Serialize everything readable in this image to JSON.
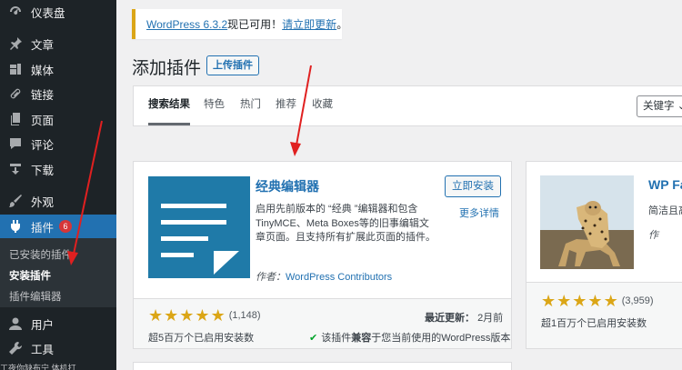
{
  "sidebar": {
    "items": [
      {
        "label": "仪表盘",
        "icon": "dashboard-icon"
      },
      {
        "label": "文章",
        "icon": "pin-icon"
      },
      {
        "label": "媒体",
        "icon": "media-icon"
      },
      {
        "label": "链接",
        "icon": "link-icon"
      },
      {
        "label": "页面",
        "icon": "page-icon"
      },
      {
        "label": "评论",
        "icon": "comment-icon"
      },
      {
        "label": "下载",
        "icon": "download-icon"
      },
      {
        "label": "外观",
        "icon": "brush-icon"
      },
      {
        "label": "插件",
        "icon": "plugin-icon",
        "badge": "6"
      },
      {
        "label": "用户",
        "icon": "user-icon"
      },
      {
        "label": "工具",
        "icon": "wrench-icon"
      }
    ],
    "submenu": [
      {
        "label": "已安装的插件"
      },
      {
        "label": "安装插件"
      },
      {
        "label": "插件编辑器"
      }
    ],
    "footer_peek": "工夜你缺布宁   体机打"
  },
  "notice": {
    "version_link": "WordPress 6.3.2",
    "middle": "现已可用！",
    "update_link": "请立即更新",
    "end": "。"
  },
  "page": {
    "title": "添加插件",
    "upload_button": "上传插件"
  },
  "filter": {
    "tabs": [
      "搜索结果",
      "特色",
      "热门",
      "推荐",
      "收藏"
    ],
    "keyword_select": "关键字 ⌄"
  },
  "plugin1": {
    "name": "经典编辑器",
    "install_button": "立即安装",
    "more_details": "更多详情",
    "description": "启用先前版本的 “经典 ”编辑器和包含TinyMCE、Meta Boxes等的旧事编辑文章页面。且支持所有扩展此页面的插件。",
    "author_prefix": "作者：",
    "author": "WordPress Contributors",
    "rating_count": "(1,148)",
    "installs": "超5百万个已启用安装数",
    "last_updated_label": "最近更新：",
    "last_updated_value": "2月前",
    "compat_prefix": "该插件",
    "compat_bold": "兼容",
    "compat_suffix": "于您当前使用的WordPress版本",
    "rating": 5
  },
  "plugin2": {
    "name": "WP Fa",
    "description": "简洁且高",
    "author_prefix": "作",
    "rating_count": "(3,959)",
    "installs": "超1百万个已启用安装数",
    "rating": 5
  },
  "colors": {
    "sidebar_bg": "#1d2327",
    "active_menu": "#2271b1",
    "link": "#2271b1",
    "star": "#dba617",
    "badge": "#d63638",
    "annotation_arrow": "#e02020"
  }
}
